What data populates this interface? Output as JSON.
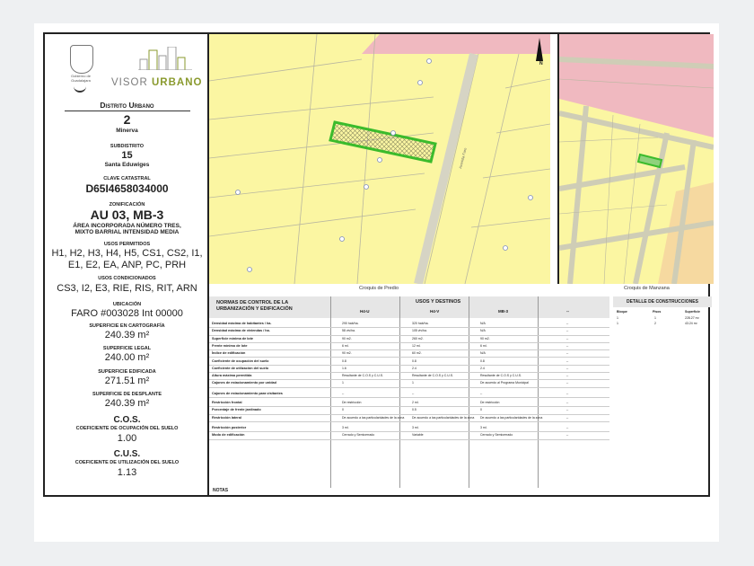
{
  "left": {
    "crest_text": "Gobierno de Guadalajara",
    "brand_a": "VISOR",
    "brand_b": "URBANO",
    "distrito_title": "Distrito Urbano",
    "distrito_num": "2",
    "distrito_name": "Minerva",
    "subdistrito_label": "SUBDISTRITO",
    "subdistrito_num": "15",
    "subdistrito_name": "Santa Eduwiges",
    "clave_label": "CLAVE CATASTRAL",
    "clave_value": "D65I4658034000",
    "zonif_label": "ZONIFICACIÓN",
    "zonif_value": "AU 03, MB-3",
    "zonif_desc1": "ÁREA INCORPORADA NÚMERO TRES,",
    "zonif_desc2": "MIXTO BARRIAL INTENSIDAD MEDIA",
    "usos_perm_label": "USOS PERMITIDOS",
    "usos_perm_1": "H1, H2, H3, H4, H5, CS1, CS2, I1,",
    "usos_perm_2": "E1, E2, EA, ANP, PC, PRH",
    "usos_cond_label": "USOS CONDICIONADOS",
    "usos_cond": "CS3, I2, E3, RIE, RIS, RIT, ARN",
    "ubic_label": "UBICACIÓN",
    "ubic_value": "FARO #003028 Int 00000",
    "sup_carto_label": "SUPERFICIE EN CARTOGRAFÍA",
    "sup_carto": "240.39 m²",
    "sup_legal_label": "SUPERFICIE LEGAL",
    "sup_legal": "240.00 m²",
    "sup_edif_label": "SUPERFICIE EDIFICADA",
    "sup_edif": "271.51 m²",
    "sup_despl_label": "SUPERFICIE DE DESPLANTE",
    "sup_despl": "240.39 m²",
    "cos_title": "C.O.S.",
    "cos_label": "COEFICIENTE DE OCUPACIÓN DEL SUELO",
    "cos_value": "1.00",
    "cus_title": "C.U.S.",
    "cus_label": "COEFICIENTE DE UTILIZACIÓN DEL SUELO",
    "cus_value": "1.13"
  },
  "maps": {
    "caption_predio": "Croquis de Predio",
    "caption_manzana": "Croquis de Manzana",
    "north_label": "N",
    "street_label": "Avenida Faro"
  },
  "table": {
    "head_left": "NORMAS DE CONTROL DE LA URBANIZACIÓN Y EDIFICACIÓN",
    "head_usos": "USOS Y DESTINOS",
    "col1": "H4-U",
    "col2": "H4-V",
    "col3": "MB-3",
    "col4": "--",
    "rows": [
      {
        "label": "Densidad máxima de habitantes / ha.",
        "v1": "290 hab/ha.",
        "v2": "320 hab/ha.",
        "v3": "N/A",
        "v4": "--"
      },
      {
        "label": "Densidad máxima de viviendas / ha.",
        "v1": "58 viv/ha.",
        "v2": "105 viv/ha.",
        "v3": "N/A",
        "v4": "--"
      },
      {
        "label": "Superficie mínima de lote",
        "v1": "90 m2.",
        "v2": "260 m2.",
        "v3": "90 m2.",
        "v4": "--"
      },
      {
        "label": "Frente mínimo de lote",
        "v1": "6 ml.",
        "v2": "12 ml.",
        "v3": "6 ml.",
        "v4": "--"
      },
      {
        "label": "Índice de edificación",
        "v1": "90 m2.",
        "v2": "60 m2.",
        "v3": "N/A",
        "v4": "--"
      },
      {
        "label": "Coeficiente de ocupación del suelo",
        "v1": "0.8",
        "v2": "0.8",
        "v3": "0.8",
        "v4": "--"
      },
      {
        "label": "Coeficiente de utilización del suelo",
        "v1": "1.6",
        "v2": "2.4",
        "v3": "2.4",
        "v4": "--"
      },
      {
        "label": "Altura máxima permitida",
        "v1": "Resultante de C.O.S y C.U.S.",
        "v2": "Resultante de C.O.S y C.U.S.",
        "v3": "Resultante de C.O.S y C.U.S.",
        "v4": "--"
      },
      {
        "label": "Cajones de estacionamiento por unidad",
        "v1": "1",
        "v2": "1",
        "v3": "De acuerdo al Programa Municipal",
        "v4": "--"
      },
      {
        "label": "Cajones de estacionamiento para visitantes",
        "v1": "--",
        "v2": "--",
        "v3": "--",
        "v4": "--"
      },
      {
        "label": "Restricción frontal",
        "v1": "De restricción",
        "v2": "2 ml.",
        "v3": "De restricción",
        "v4": "--"
      },
      {
        "label": "Porcentaje de frente jardinado",
        "v1": "0",
        "v2": "0.5",
        "v3": "0",
        "v4": "--"
      },
      {
        "label": "Restricción lateral",
        "v1": "De acuerdo a las particularidades de la zona",
        "v2": "De acuerdo a las particularidades de la zona",
        "v3": "De acuerdo a las particularidades de la zona",
        "v4": "--"
      },
      {
        "label": "Restricción posterior",
        "v1": "3 ml.",
        "v2": "3 ml.",
        "v3": "3 ml.",
        "v4": "--"
      },
      {
        "label": "Modo de edificación",
        "v1": "Cerrado y Semicerrado",
        "v2": "Variable",
        "v3": "Cerrado y Semicerrado",
        "v4": "--"
      }
    ],
    "notas": "NOTAS"
  },
  "detalle": {
    "title": "DETALLE DE CONSTRUCCIONES",
    "h1": "Bloque",
    "h2": "Pisos",
    "h3": "Superficie",
    "rows": [
      {
        "b": "1",
        "p": "1",
        "s": "228.27 m²"
      },
      {
        "b": "1",
        "p": "2",
        "s": "43.24 m²"
      }
    ]
  },
  "colors": {
    "zone_yellow": "#fbf6a2",
    "zone_pink": "#f0b9c0",
    "lot_green": "#3bbb2c"
  }
}
